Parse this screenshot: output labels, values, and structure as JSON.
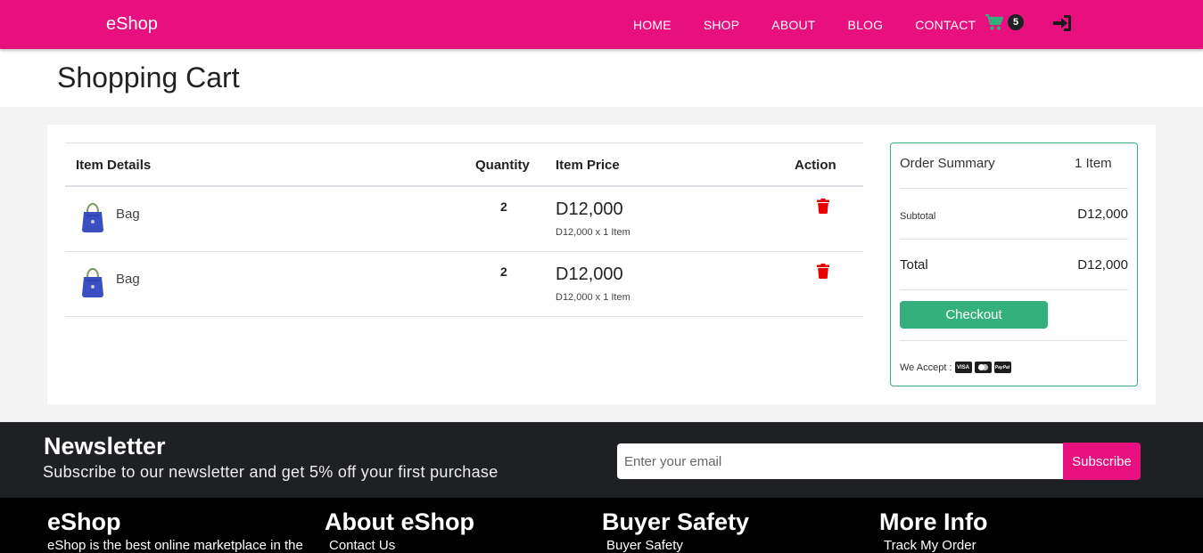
{
  "nav": {
    "brand": "eShop",
    "links": [
      "HOME",
      "SHOP",
      "ABOUT",
      "BLOG",
      "CONTACT"
    ],
    "cart_count": "5"
  },
  "page": {
    "title": "Shopping Cart"
  },
  "table": {
    "headers": {
      "item": "Item Details",
      "quantity": "Quantity",
      "price": "Item Price",
      "action": "Action"
    },
    "rows": [
      {
        "name": "Bag",
        "quantity": "2",
        "price": "D12,000",
        "subtext": "D12,000 x 1 Item"
      },
      {
        "name": "Bag",
        "quantity": "2",
        "price": "D12,000",
        "subtext": "D12,000 x 1 Item"
      }
    ]
  },
  "summary": {
    "title": "Order Summary",
    "count": "1 Item",
    "subtotal_label": "Subtotal",
    "subtotal_value": "D12,000",
    "total_label": "Total",
    "total_value": "D12,000",
    "checkout_label": "Checkout",
    "accept_label": "We Accept :",
    "cards": [
      "VISA",
      "MC",
      "PayPal"
    ]
  },
  "newsletter": {
    "title": "Newsletter",
    "subtitle": "Subscribe to our newsletter and get 5% off your first purchase",
    "placeholder": "Enter your email",
    "button": "Subscribe"
  },
  "footer": {
    "columns": [
      {
        "title": "eShop",
        "text": "eShop is the best online marketplace in the"
      },
      {
        "title": "About eShop",
        "text": "Contact Us"
      },
      {
        "title": "Buyer Safety",
        "text": "Buyer Safety"
      },
      {
        "title": "More Info",
        "text": "Track My Order"
      }
    ]
  },
  "colors": {
    "brand": "#e8107e",
    "accent_green": "#34b07c",
    "danger": "#e60000",
    "dark": "#1f2024"
  }
}
